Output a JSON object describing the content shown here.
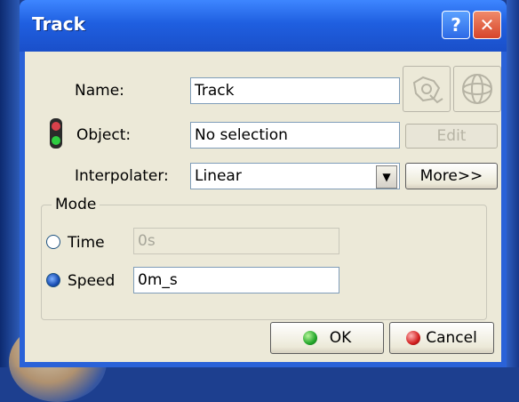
{
  "window": {
    "title": "Track",
    "help_symbol": "?",
    "close_symbol": "✕"
  },
  "fields": {
    "name": {
      "label": "Name:",
      "value": "Track"
    },
    "object": {
      "label": "Object:",
      "value": "No selection",
      "edit_label": "Edit"
    },
    "interpolater": {
      "label": "Interpolater:",
      "value": "Linear",
      "more_label": "More>>"
    }
  },
  "mode": {
    "legend": "Mode",
    "time": {
      "label": "Time",
      "value": "0s",
      "selected": false
    },
    "speed": {
      "label": "Speed",
      "value": "0m_s",
      "selected": true
    }
  },
  "buttons": {
    "ok": "OK",
    "cancel": "Cancel"
  },
  "icons": [
    "camera-icon",
    "sphere-icon",
    "traffic-light-icon",
    "dropdown-arrow-icon",
    "ok-green-dot-icon",
    "cancel-red-dot-icon"
  ]
}
